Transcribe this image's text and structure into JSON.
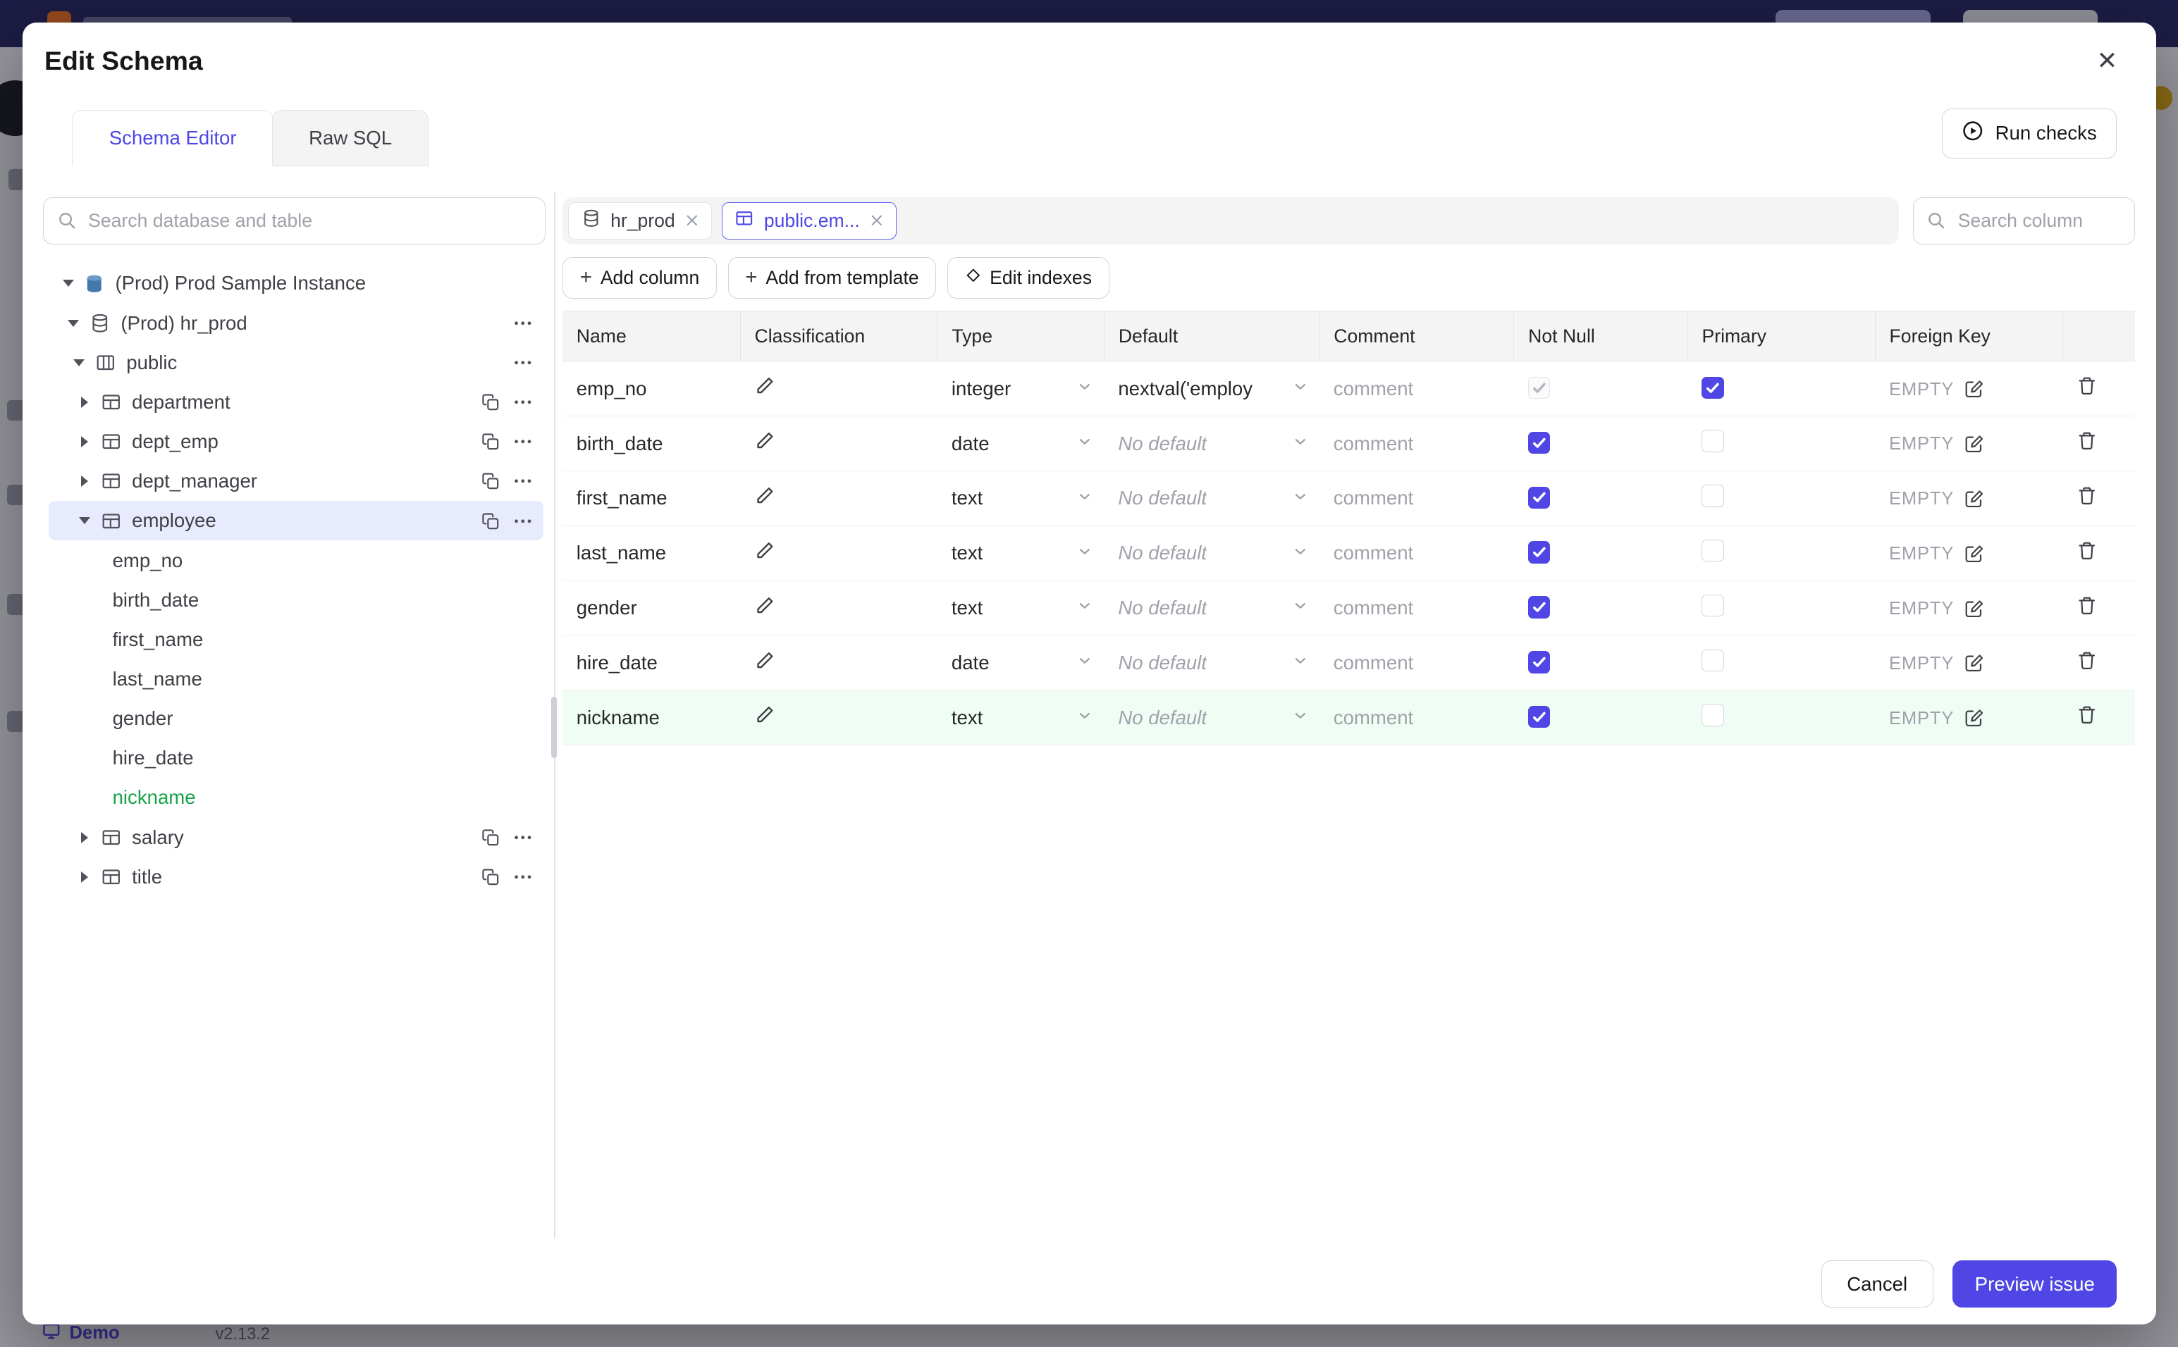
{
  "background": {
    "demo_label": "Demo",
    "version": "v2.13.2"
  },
  "modal": {
    "title": "Edit Schema",
    "tabs": [
      {
        "label": "Schema Editor",
        "active": true
      },
      {
        "label": "Raw SQL",
        "active": false
      }
    ],
    "run_checks_label": "Run checks",
    "tree": {
      "search_placeholder": "Search database and table",
      "instance_label": "(Prod) Prod Sample Instance",
      "database_label": "(Prod) hr_prod",
      "schema_label": "public",
      "tables": [
        {
          "name": "department",
          "expanded": false,
          "selected": false
        },
        {
          "name": "dept_emp",
          "expanded": false,
          "selected": false
        },
        {
          "name": "dept_manager",
          "expanded": false,
          "selected": false
        },
        {
          "name": "employee",
          "expanded": true,
          "selected": true
        },
        {
          "name": "salary",
          "expanded": false,
          "selected": false
        },
        {
          "name": "title",
          "expanded": false,
          "selected": false
        }
      ],
      "employee_columns": [
        {
          "name": "emp_no",
          "added": false
        },
        {
          "name": "birth_date",
          "added": false
        },
        {
          "name": "first_name",
          "added": false
        },
        {
          "name": "last_name",
          "added": false
        },
        {
          "name": "gender",
          "added": false
        },
        {
          "name": "hire_date",
          "added": false
        },
        {
          "name": "nickname",
          "added": true
        }
      ]
    },
    "editor": {
      "chips": [
        {
          "label": "hr_prod",
          "active": false
        },
        {
          "label": "public.em...",
          "active": true
        }
      ],
      "column_search_placeholder": "Search column",
      "toolbar": [
        {
          "label": "Add column"
        },
        {
          "label": "Add from template"
        },
        {
          "label": "Edit indexes"
        }
      ],
      "table": {
        "headers": [
          "Name",
          "Classification",
          "Type",
          "Default",
          "Comment",
          "Not Null",
          "Primary",
          "Foreign Key"
        ],
        "comment_placeholder": "comment",
        "fk_empty_label": "EMPTY",
        "rows": [
          {
            "name": "emp_no",
            "type": "integer",
            "default": "nextval('employ",
            "default_is_placeholder": false,
            "not_null": "checked-disabled",
            "primary": "checked",
            "added": false
          },
          {
            "name": "birth_date",
            "type": "date",
            "default": "No default",
            "default_is_placeholder": true,
            "not_null": "checked",
            "primary": "unchecked",
            "added": false
          },
          {
            "name": "first_name",
            "type": "text",
            "default": "No default",
            "default_is_placeholder": true,
            "not_null": "checked",
            "primary": "unchecked",
            "added": false
          },
          {
            "name": "last_name",
            "type": "text",
            "default": "No default",
            "default_is_placeholder": true,
            "not_null": "checked",
            "primary": "unchecked",
            "added": false
          },
          {
            "name": "gender",
            "type": "text",
            "default": "No default",
            "default_is_placeholder": true,
            "not_null": "checked",
            "primary": "unchecked",
            "added": false
          },
          {
            "name": "hire_date",
            "type": "date",
            "default": "No default",
            "default_is_placeholder": true,
            "not_null": "checked",
            "primary": "unchecked",
            "added": false
          },
          {
            "name": "nickname",
            "type": "text",
            "default": "No default",
            "default_is_placeholder": true,
            "not_null": "checked",
            "primary": "unchecked",
            "added": true
          }
        ]
      }
    },
    "footer": {
      "cancel_label": "Cancel",
      "primary_label": "Preview issue"
    },
    "colors": {
      "accent": "#4f46e5",
      "added_text": "#16a34a",
      "added_row_bg": "#f0fdf4"
    }
  }
}
